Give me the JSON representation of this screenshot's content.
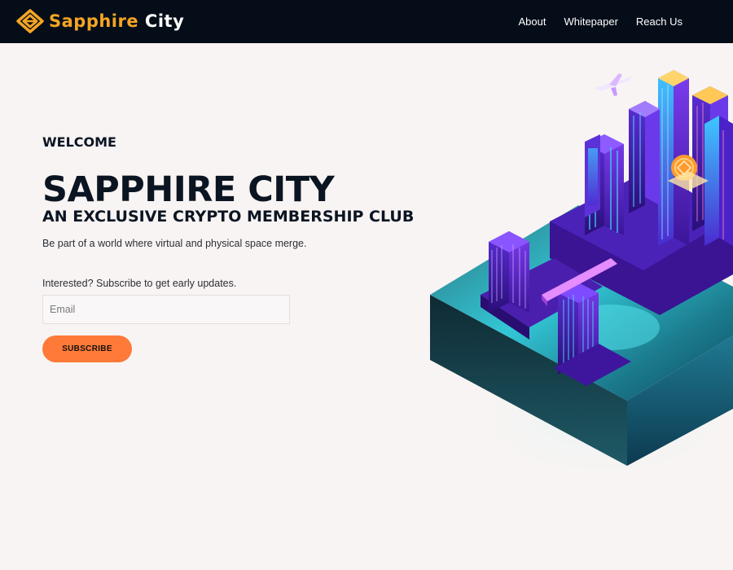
{
  "brand": {
    "name_part1": "Sapphire",
    "name_part2": "City",
    "logo_icon": "diamond-logo-icon",
    "primary_color": "#f5a524"
  },
  "nav": {
    "links": [
      {
        "label": "About"
      },
      {
        "label": "Whitepaper"
      },
      {
        "label": "Reach Us"
      }
    ]
  },
  "hero": {
    "eyebrow": "WELCOME",
    "title": "SAPPHIRE CITY",
    "subtitle": "AN EXCLUSIVE CRYPTO MEMBERSHIP CLUB",
    "tagline": "Be part of a world where virtual and physical space merge.",
    "cta_text": "Interested? Subscribe to get early updates.",
    "email_placeholder": "Email",
    "subscribe_label": "SUBSCRIBE",
    "button_color": "#ff7a38",
    "illustration": "isometric-city-illustration"
  }
}
